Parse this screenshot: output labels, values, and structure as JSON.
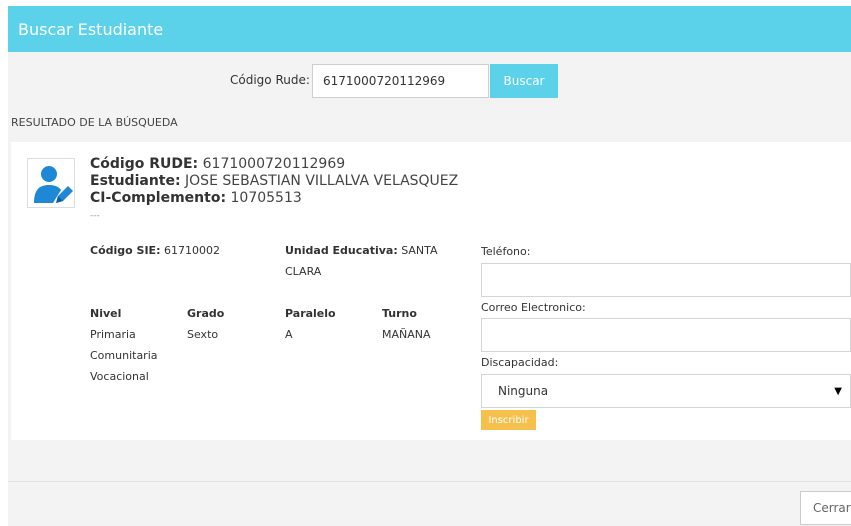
{
  "header": {
    "title": "Buscar Estudiante"
  },
  "search": {
    "label": "Código Rude:",
    "value": "6171000720112969",
    "button": "Buscar"
  },
  "results_title": "RESULTADO DE LA BÚSQUEDA",
  "student": {
    "rude_label": "Código RUDE:",
    "rude": "6171000720112969",
    "name_label": "Estudiante:",
    "name": "JOSE SEBASTIAN VILLALVA VELASQUEZ",
    "ci_label": "CI-Complemento:",
    "ci": "10705513",
    "dash": "---",
    "sie_label": "Código SIE:",
    "sie": "61710002",
    "ue_label": "Unidad Educativa:",
    "ue_line1": "SANTA",
    "ue_line2": "CLARA",
    "nivel_label": "Nivel",
    "nivel_lines": [
      "Primaria",
      "Comunitaria",
      "Vocacional"
    ],
    "grado_label": "Grado",
    "grado": "Sexto",
    "paralelo_label": "Paralelo",
    "paralelo": "A",
    "turno_label": "Turno",
    "turno": "MAÑANA"
  },
  "form": {
    "phone_label": "Teléfono:",
    "phone_value": "",
    "email_label": "Correo Electronico:",
    "email_value": "",
    "disability_label": "Discapacidad:",
    "disability_value": "Ninguna",
    "enroll_button": "Inscribir"
  },
  "footer": {
    "close_button": "Cerrar"
  },
  "colors": {
    "header_bg": "#5cd2ea",
    "button_primary": "#5cd2ea",
    "button_enroll": "#f6c04d",
    "avatar_icon": "#1e88d6"
  },
  "icons": {
    "avatar": "user-edit-icon",
    "select": "caret-down-icon"
  }
}
